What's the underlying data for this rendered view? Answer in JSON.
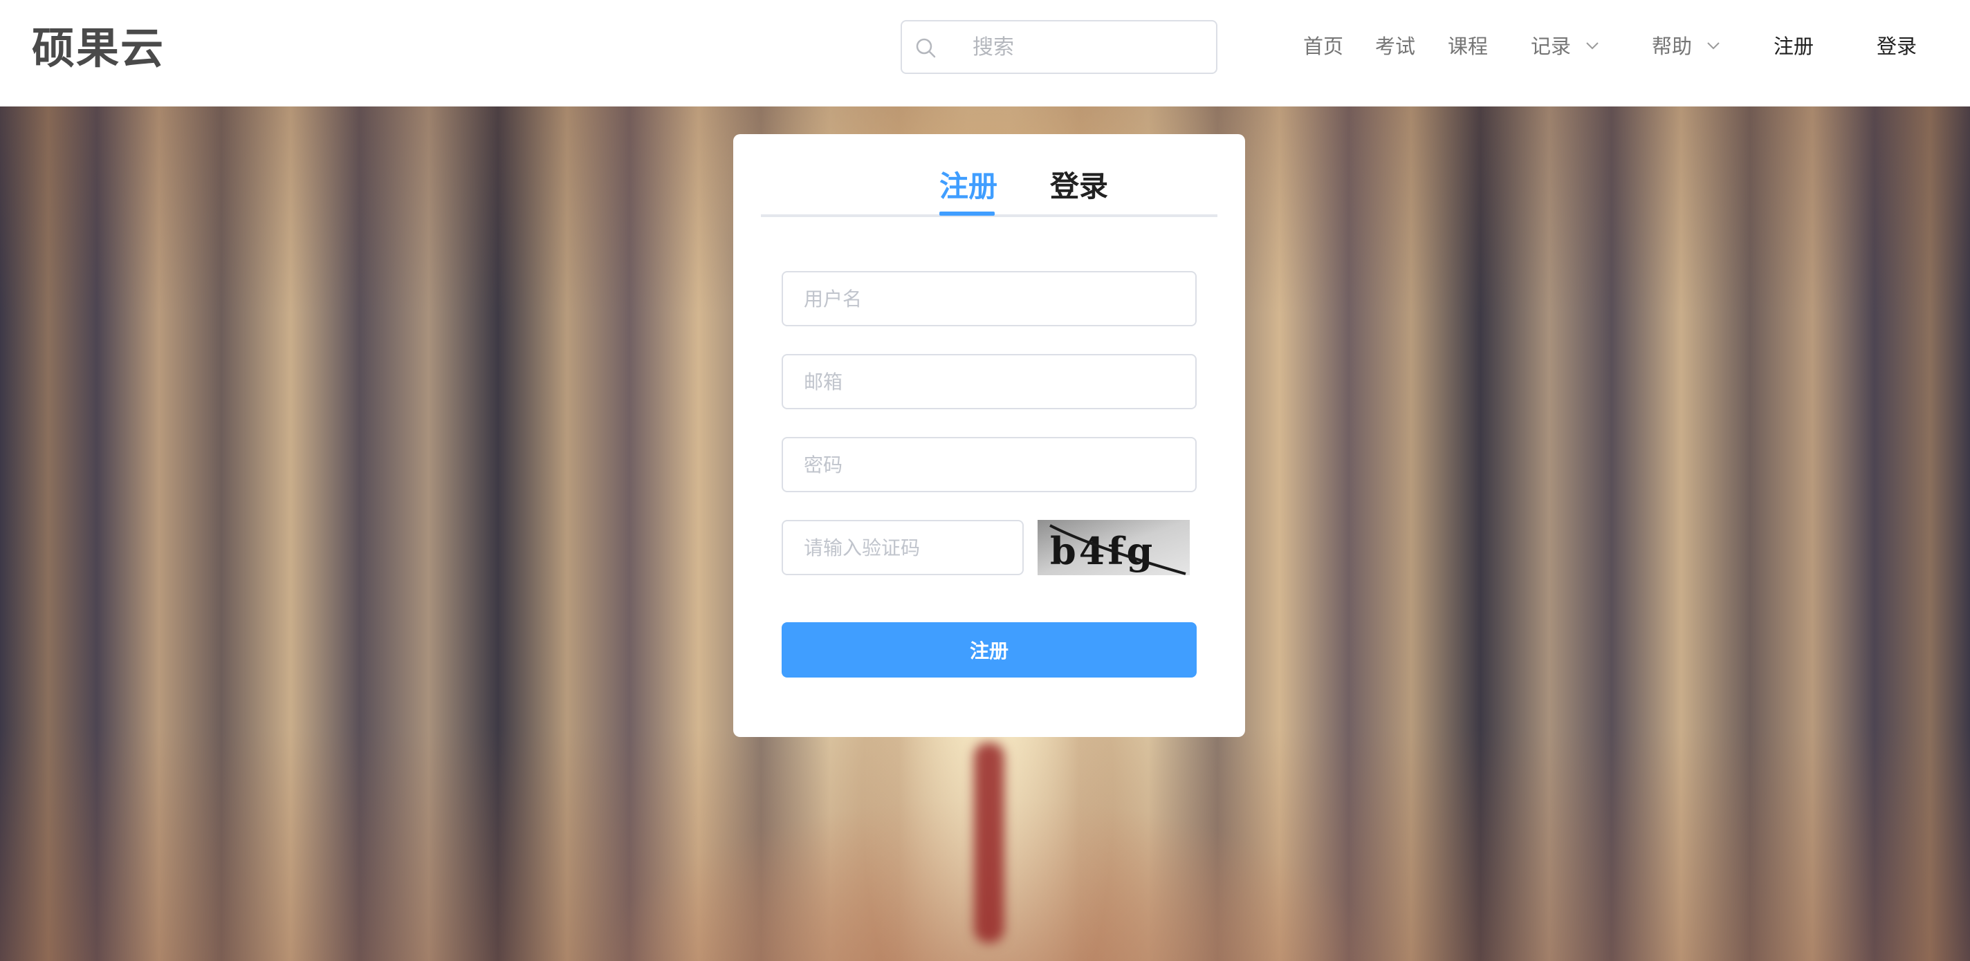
{
  "header": {
    "logo": "硕果云",
    "search_placeholder": "搜索",
    "nav": {
      "home": "首页",
      "exam": "考试",
      "course": "课程",
      "records": "记录",
      "help": "帮助",
      "register": "注册",
      "login": "登录"
    }
  },
  "form": {
    "tabs": {
      "register": "注册",
      "login": "登录"
    },
    "active_tab": "register",
    "username_placeholder": "用户名",
    "email_placeholder": "邮箱",
    "password_placeholder": "密码",
    "captcha_placeholder": "请输入验证码",
    "captcha_text": "b4fg",
    "submit_label": "注册"
  },
  "colors": {
    "accent": "#409eff",
    "logo": "#4a4a4a",
    "nav_text": "#757575",
    "nav_strong": "#1f1f1f"
  }
}
